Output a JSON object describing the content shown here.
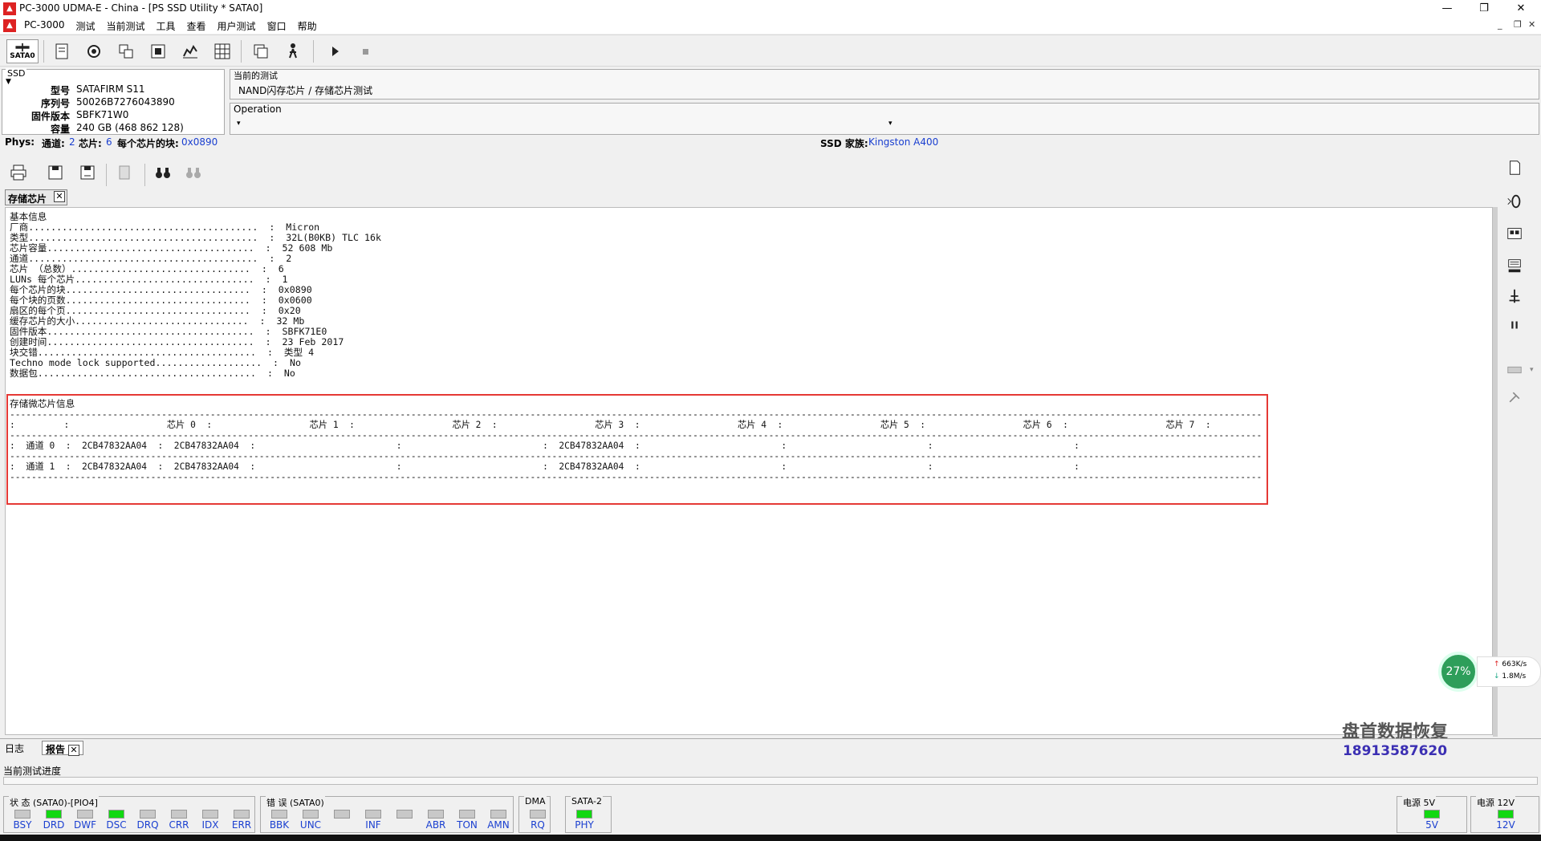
{
  "window": {
    "title": "PC-3000 UDMA-E - China - [PS SSD Utility * SATA0]"
  },
  "menu": {
    "items": [
      "PC-3000",
      "测试",
      "当前测试",
      "工具",
      "查看",
      "用户测试",
      "窗口",
      "帮助"
    ]
  },
  "toolbar": {
    "sata_label": "SATA0"
  },
  "ssd": {
    "legend": "SSD",
    "fields": [
      {
        "key": "型号",
        "value": "SATAFIRM   S11"
      },
      {
        "key": "序列号",
        "value": "50026B7276043890"
      },
      {
        "key": "固件版本",
        "value": "SBFK71W0"
      },
      {
        "key": "容量",
        "value": "240 GB (468 862 128)"
      }
    ]
  },
  "current_test": {
    "legend": "当前的测试",
    "value": "NAND闪存芯片 / 存储芯片测试"
  },
  "operation": {
    "legend": "Operation"
  },
  "phys": {
    "label": "Phys:",
    "channels_label": "通道:",
    "channels": "2",
    "chips_label": "芯片:",
    "chips": "6",
    "blocks_label": "每个芯片的块:",
    "blocks": "0x0890",
    "family_label": "SSD 家族:",
    "family": "Kingston A400"
  },
  "doc_tab": {
    "label": "存储芯片"
  },
  "report": {
    "basic_title": "基本信息",
    "basic_rows": [
      "厂商.........................................  :  Micron",
      "类型.........................................  :  32L(B0KB) TLC 16k",
      "芯片容量.....................................  :  52 608 Mb",
      "通道.........................................  :  2",
      "芯片 （总数）................................  :  6",
      "LUNs 每个芯片................................  :  1",
      "每个芯片的块.................................  :  0x0890",
      "每个块的页数.................................  :  0x0600",
      "扇区的每个页.................................  :  0x20",
      "缓存芯片的大小...............................  :  32 Mb",
      "固件版本.....................................  :  SBFK71E0",
      "创建时间.....................................  :  23 Feb 2017",
      "块交错.......................................  :  类型 4",
      "Techno mode lock supported...................  :  No",
      "数据包.......................................  :  No"
    ],
    "chip_title": "存储微芯片信息",
    "chip_rows": [
      "---------------------------------------------------------------------------------------------------------------------------------------------------------------------------------------------------------------------------------------",
      ":         :                  芯片 0  :                  芯片 1  :                  芯片 2  :                  芯片 3  :                  芯片 4  :                  芯片 5  :                  芯片 6  :                  芯片 7  :",
      "---------------------------------------------------------------------------------------------------------------------------------------------------------------------------------------------------------------------------------------",
      ":  通道 0  :  2CB47832AA04  :  2CB47832AA04  :                          :                          :  2CB47832AA04  :                          :                          :                          :",
      "---------------------------------------------------------------------------------------------------------------------------------------------------------------------------------------------------------------------------------------",
      ":  通道 1  :  2CB47832AA04  :  2CB47832AA04  :                          :                          :  2CB47832AA04  :                          :                          :                          :",
      "---------------------------------------------------------------------------------------------------------------------------------------------------------------------------------------------------------------------------------------"
    ]
  },
  "widget": {
    "percent": "27%",
    "up": "663K/s",
    "down": "1.8M/s"
  },
  "watermark": {
    "company": "盘首数据恢复",
    "phone": "18913587620"
  },
  "bottom_tabs": {
    "log": "日志",
    "report": "报告"
  },
  "progress": {
    "label": "当前测试进度"
  },
  "status_groups": [
    {
      "legend": "状 态 (SATA0)-[PIO4]",
      "leds": [
        {
          "label": "BSY",
          "on": false
        },
        {
          "label": "DRD",
          "on": true
        },
        {
          "label": "DWF",
          "on": false
        },
        {
          "label": "DSC",
          "on": true
        },
        {
          "label": "DRQ",
          "on": false
        },
        {
          "label": "CRR",
          "on": false
        },
        {
          "label": "IDX",
          "on": false
        },
        {
          "label": "ERR",
          "on": false
        }
      ]
    },
    {
      "legend": "错 误 (SATA0)",
      "leds": [
        {
          "label": "BBK",
          "on": false
        },
        {
          "label": "UNC",
          "on": false
        },
        {
          "label": "",
          "on": false
        },
        {
          "label": "INF",
          "on": false
        },
        {
          "label": "",
          "on": false
        },
        {
          "label": "ABR",
          "on": false
        },
        {
          "label": "TON",
          "on": false
        },
        {
          "label": "AMN",
          "on": false
        }
      ]
    },
    {
      "legend": "DMA",
      "leds": [
        {
          "label": "RQ",
          "on": false
        }
      ]
    },
    {
      "legend": "SATA-2",
      "leds": [
        {
          "label": "PHY",
          "on": true
        }
      ]
    }
  ],
  "power": [
    {
      "legend": "电源 5V",
      "label": "5V",
      "on": true
    },
    {
      "legend": "电源 12V",
      "label": "12V",
      "on": true
    }
  ],
  "colors": {
    "led_on": "#11d811",
    "highlight_box": "#e53935",
    "link_blue": "#1a3fd0"
  }
}
